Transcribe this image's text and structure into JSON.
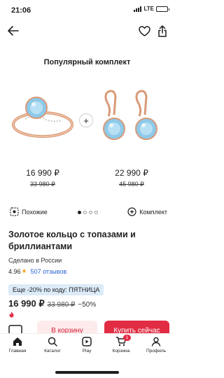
{
  "status_bar": {
    "time": "21:06",
    "network": "LTE"
  },
  "section": {
    "title": "Популярный комплект"
  },
  "products": [
    {
      "price": "16 990 ₽",
      "old_price": "33 980 ₽"
    },
    {
      "price": "22 990 ₽",
      "old_price": "45 980 ₽"
    }
  ],
  "actions": {
    "similar_label": "Похожие",
    "set_label": "Комплект"
  },
  "item": {
    "title": "Золотое кольцо с топазами и бриллиантами",
    "made_in": "Сделано в России",
    "rating": "4.96",
    "reviews": "507 отзывов",
    "promo": "Еще -20% по коду: ПЯТНИЦА",
    "price": "16 990 ₽",
    "old_price": "33 980 ₽",
    "discount": "−50%"
  },
  "buttons": {
    "cart": "В корзину",
    "buy": "Купить сейчас"
  },
  "tab_bar": {
    "tabs": [
      {
        "label": "Главная",
        "icon": "home-icon"
      },
      {
        "label": "Каталог",
        "icon": "catalog-icon"
      },
      {
        "label": "Play",
        "icon": "play-icon"
      },
      {
        "label": "Корзина",
        "icon": "cart-icon"
      },
      {
        "label": "Профиль",
        "icon": "profile-icon"
      }
    ],
    "cart_count": "1"
  },
  "colors": {
    "accent": "#e22c44",
    "promo_bg": "#dcebf8",
    "link": "#2a62d6",
    "star": "#f5a524"
  }
}
